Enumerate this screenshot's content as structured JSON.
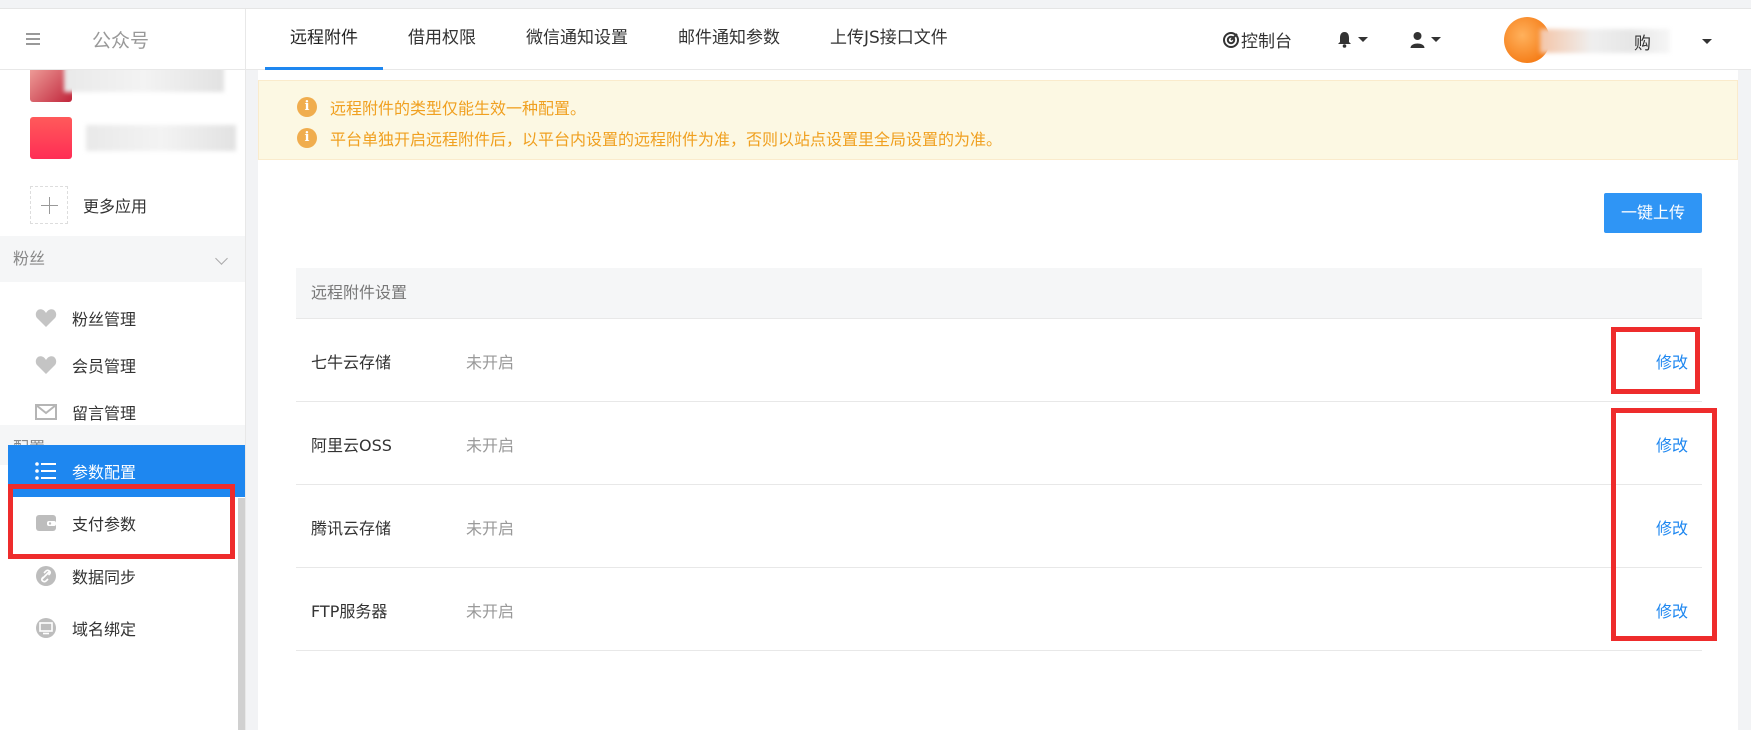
{
  "header": {
    "brand_title": "公众号",
    "tabs": [
      {
        "label": "远程附件",
        "active": true
      },
      {
        "label": "借用权限",
        "active": false
      },
      {
        "label": "微信通知设置",
        "active": false
      },
      {
        "label": "邮件通知参数",
        "active": false
      },
      {
        "label": "上传JS接口文件",
        "active": false
      }
    ],
    "console_label": "控制台",
    "account_name_suffix": "购",
    "icons": {
      "menu": "menu-icon",
      "console": "target-icon",
      "bell": "bell-icon",
      "user": "user-icon"
    }
  },
  "sidebar": {
    "more_apps_label": "更多应用",
    "groups": [
      {
        "title": "粉丝",
        "items": [
          {
            "label": "粉丝管理",
            "icon": "heart-icon"
          },
          {
            "label": "会员管理",
            "icon": "heart-icon"
          },
          {
            "label": "留言管理",
            "icon": "mail-icon"
          }
        ]
      },
      {
        "title": "配置",
        "items": [
          {
            "label": "参数配置",
            "icon": "list-icon",
            "active": true
          },
          {
            "label": "支付参数",
            "icon": "wallet-icon"
          },
          {
            "label": "数据同步",
            "icon": "link-icon"
          },
          {
            "label": "域名绑定",
            "icon": "monitor-icon"
          }
        ]
      }
    ]
  },
  "main": {
    "notices": [
      "远程附件的类型仅能生效一种配置。",
      "平台单独开启远程附件后，以平台内设置的远程附件为准，否则以站点设置里全局设置的为准。"
    ],
    "upload_button": "一键上传",
    "panel_title": "远程附件设置",
    "rows": [
      {
        "name": "七牛云存储",
        "status": "未开启",
        "action": "修改"
      },
      {
        "name": "阿里云OSS",
        "status": "未开启",
        "action": "修改"
      },
      {
        "name": "腾讯云存储",
        "status": "未开启",
        "action": "修改"
      },
      {
        "name": "FTP服务器",
        "status": "未开启",
        "action": "修改"
      }
    ]
  },
  "colors": {
    "accent": "#1e87f0",
    "notice_text": "#f0a020",
    "highlight": "#ee2c2c"
  }
}
